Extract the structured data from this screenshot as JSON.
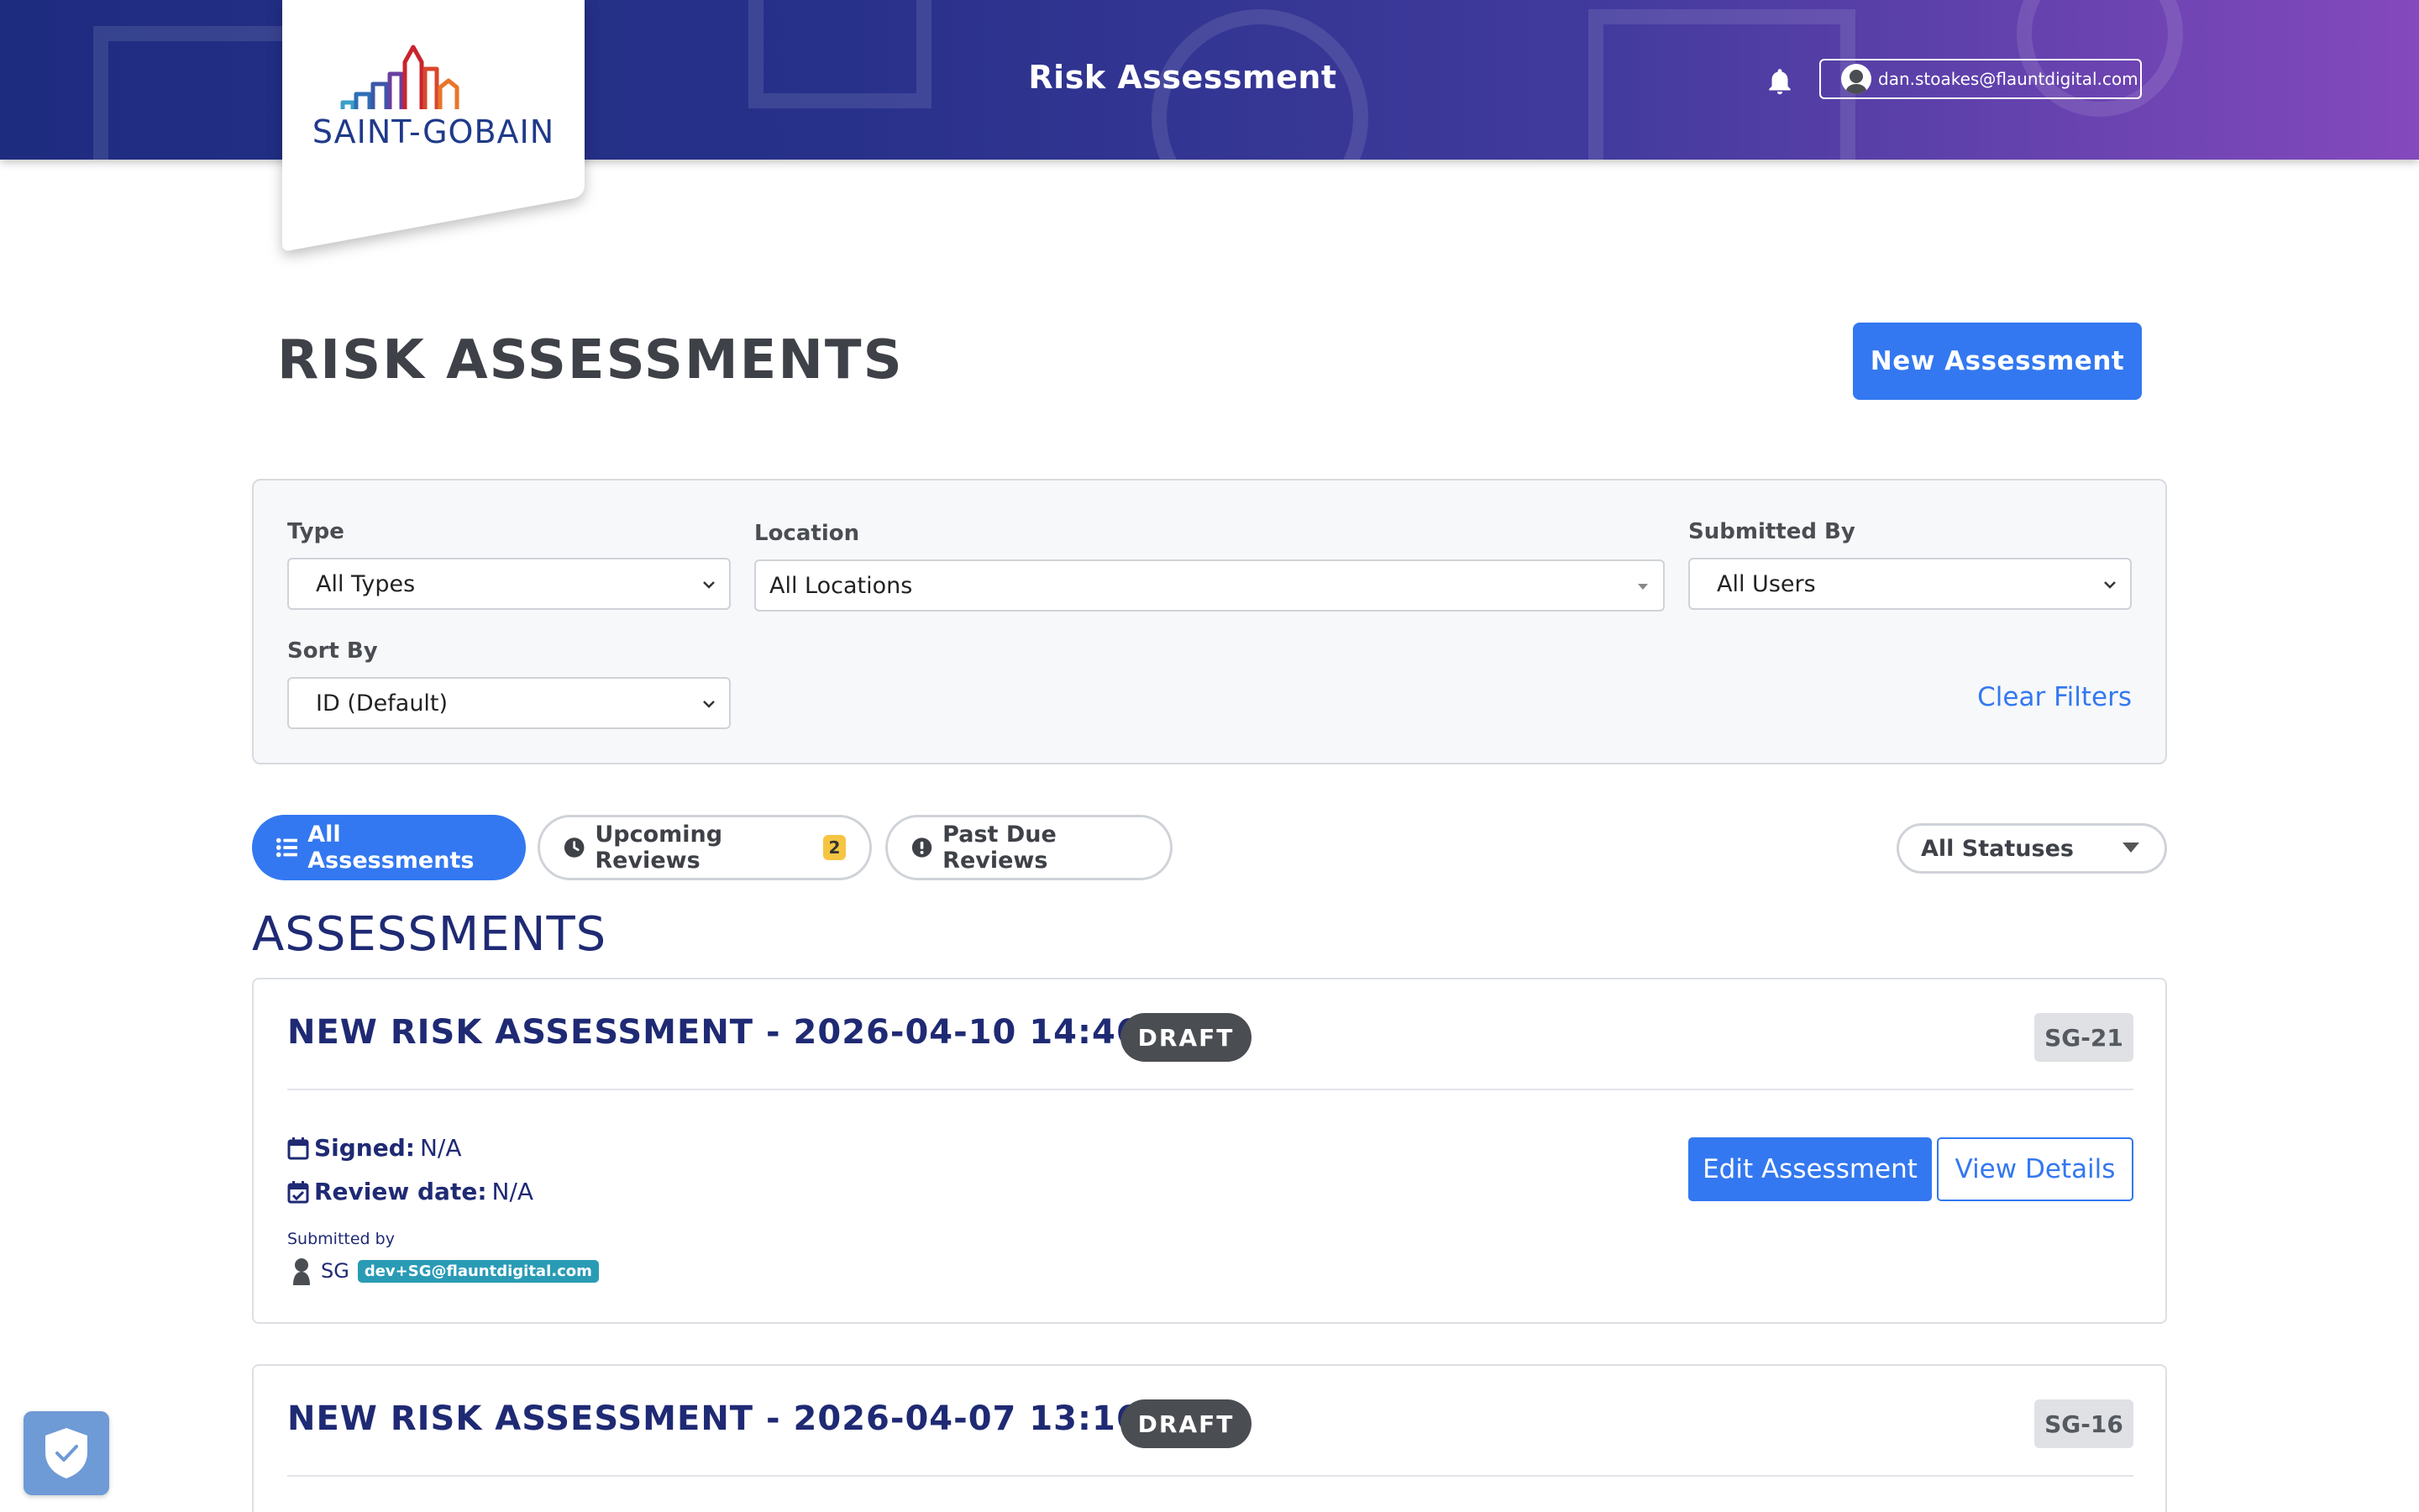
{
  "header": {
    "title": "Risk Assessment",
    "user_email": "dan.stoakes@flauntdigital.com"
  },
  "logo": {
    "text": "SAINT-GOBAIN"
  },
  "page": {
    "title": "RISK ASSESSMENTS",
    "new_button": "New Assessment"
  },
  "filters": {
    "type_label": "Type",
    "type_value": "All Types",
    "location_label": "Location",
    "location_value": "All Locations",
    "submitted_by_label": "Submitted By",
    "submitted_by_value": "All Users",
    "sort_label": "Sort By",
    "sort_value": "ID (Default)",
    "clear_label": "Clear Filters"
  },
  "tabs": {
    "all": "All Assessments",
    "upcoming": "Upcoming Reviews",
    "upcoming_count": "2",
    "past_due": "Past Due Reviews",
    "status_filter": "All Statuses"
  },
  "section_heading": "ASSESSMENTS",
  "assessments": [
    {
      "title": "NEW RISK ASSESSMENT - 2026-04-10 14:46:16",
      "status": "DRAFT",
      "id": "SG-21",
      "signed_label": "Signed:",
      "signed_value": "N/A",
      "review_label": "Review date:",
      "review_value": "N/A",
      "submitted_by_label": "Submitted by",
      "submitter_initials": "SG",
      "submitter_email": "dev+SG@flauntdigital.com",
      "edit_button": "Edit Assessment",
      "view_button": "View Details"
    },
    {
      "title": "NEW RISK ASSESSMENT - 2026-04-07 13:16:57",
      "status": "DRAFT",
      "id": "SG-16"
    }
  ],
  "colors": {
    "primary": "#3378f0",
    "navy": "#1f2a74",
    "header_start": "#1e2c80",
    "header_end": "#8449bd",
    "draft": "#4a4d52",
    "badge_yellow": "#f5c542",
    "email_tag": "#2a9bb5"
  },
  "icons": [
    "bell-icon",
    "user-avatar-icon",
    "list-icon",
    "clock-icon",
    "alert-circle-icon",
    "calendar-icon",
    "calendar-check-icon",
    "person-icon",
    "shield-check-icon",
    "chevron-down-icon"
  ]
}
